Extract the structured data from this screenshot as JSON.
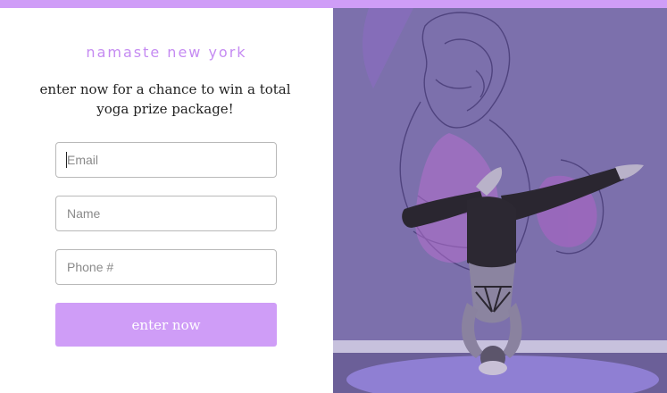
{
  "brand": {
    "name": "namaste new york",
    "accent_color": "#cf9df7"
  },
  "headline": {
    "text": "enter now for a chance to win a total yoga prize package!"
  },
  "form": {
    "email_placeholder": "Email",
    "name_placeholder": "Name",
    "phone_placeholder": "Phone #",
    "submit_label": "enter now"
  },
  "hero": {
    "tint_color": "#7a6da6"
  }
}
